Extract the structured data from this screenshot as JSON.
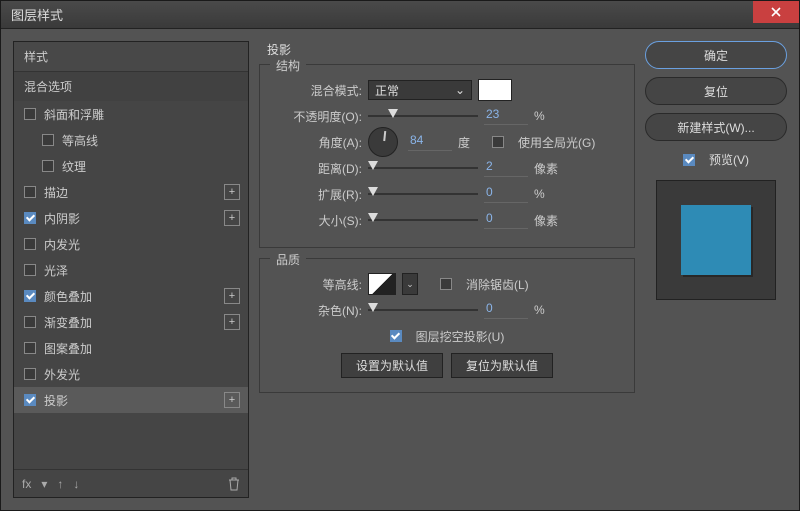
{
  "window": {
    "title": "图层样式"
  },
  "left": {
    "header": "样式",
    "subheader": "混合选项",
    "items": [
      {
        "label": "斜面和浮雕",
        "checked": false,
        "plus": false,
        "indent": false
      },
      {
        "label": "等高线",
        "checked": false,
        "plus": false,
        "indent": true
      },
      {
        "label": "纹理",
        "checked": false,
        "plus": false,
        "indent": true
      },
      {
        "label": "描边",
        "checked": false,
        "plus": true,
        "indent": false
      },
      {
        "label": "内阴影",
        "checked": true,
        "plus": true,
        "indent": false
      },
      {
        "label": "内发光",
        "checked": false,
        "plus": false,
        "indent": false
      },
      {
        "label": "光泽",
        "checked": false,
        "plus": false,
        "indent": false
      },
      {
        "label": "颜色叠加",
        "checked": true,
        "plus": true,
        "indent": false
      },
      {
        "label": "渐变叠加",
        "checked": false,
        "plus": true,
        "indent": false
      },
      {
        "label": "图案叠加",
        "checked": false,
        "plus": false,
        "indent": false
      },
      {
        "label": "外发光",
        "checked": false,
        "plus": false,
        "indent": false
      },
      {
        "label": "投影",
        "checked": true,
        "plus": true,
        "indent": false,
        "selected": true
      }
    ],
    "footer_fx": "fx"
  },
  "center": {
    "title": "投影",
    "group1": "结构",
    "blend_label": "混合模式:",
    "blend_value": "正常",
    "opacity_label": "不透明度(O):",
    "opacity_value": "23",
    "angle_label": "角度(A):",
    "angle_value": "84",
    "angle_unit": "度",
    "global_label": "使用全局光(G)",
    "distance_label": "距离(D):",
    "distance_value": "2",
    "distance_unit": "像素",
    "spread_label": "扩展(R):",
    "spread_value": "0",
    "size_label": "大小(S):",
    "size_value": "0",
    "size_unit": "像素",
    "group2": "品质",
    "contour_label": "等高线:",
    "antialias_label": "消除锯齿(L)",
    "noise_label": "杂色(N):",
    "noise_value": "0",
    "knockout_label": "图层挖空投影(U)",
    "percent": "%",
    "btn_default": "设置为默认值",
    "btn_reset": "复位为默认值"
  },
  "right": {
    "ok": "确定",
    "cancel": "复位",
    "newstyle": "新建样式(W)...",
    "preview": "预览(V)"
  }
}
